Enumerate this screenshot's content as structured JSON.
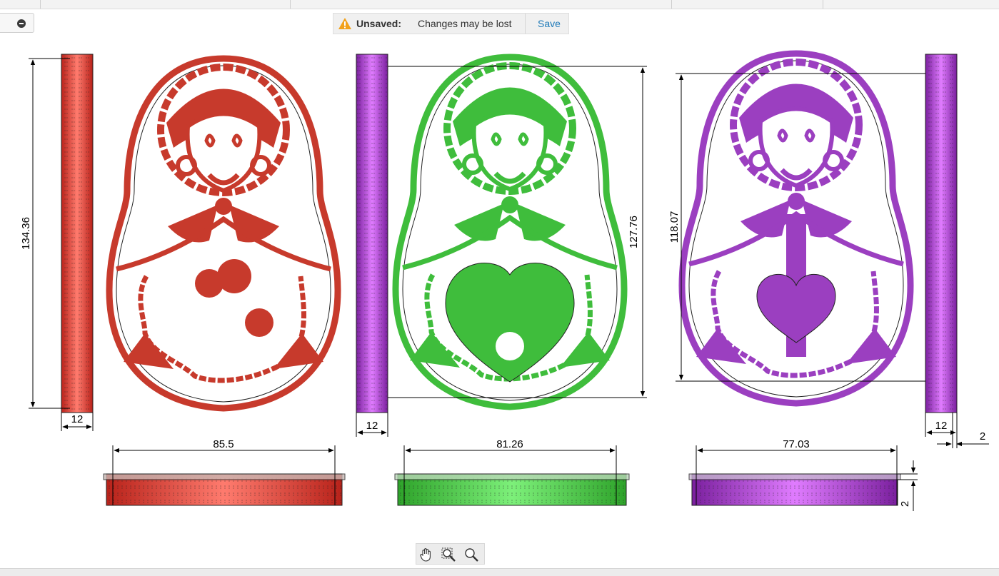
{
  "notice": {
    "label": "Unsaved:",
    "message": "Changes may be lost",
    "save_label": "Save",
    "icon": "warning-icon",
    "warning_color": "#f2a11a"
  },
  "tools": [
    "pan-hand-icon",
    "zoom-window-icon",
    "zoom-icon"
  ],
  "dimensions": {
    "red_height": "134.36",
    "red_thickness": "12",
    "red_width": "85.5",
    "green_height": "127.76",
    "green_thickness": "12",
    "green_width": "81.26",
    "purple_height": "118.07",
    "purple_thickness": "12",
    "purple_width": "77.03",
    "wall": "2",
    "height_2": "2"
  },
  "colors": {
    "red": "#c73a2c",
    "green": "#3fbd3c",
    "purple": "#9b3fc0"
  }
}
